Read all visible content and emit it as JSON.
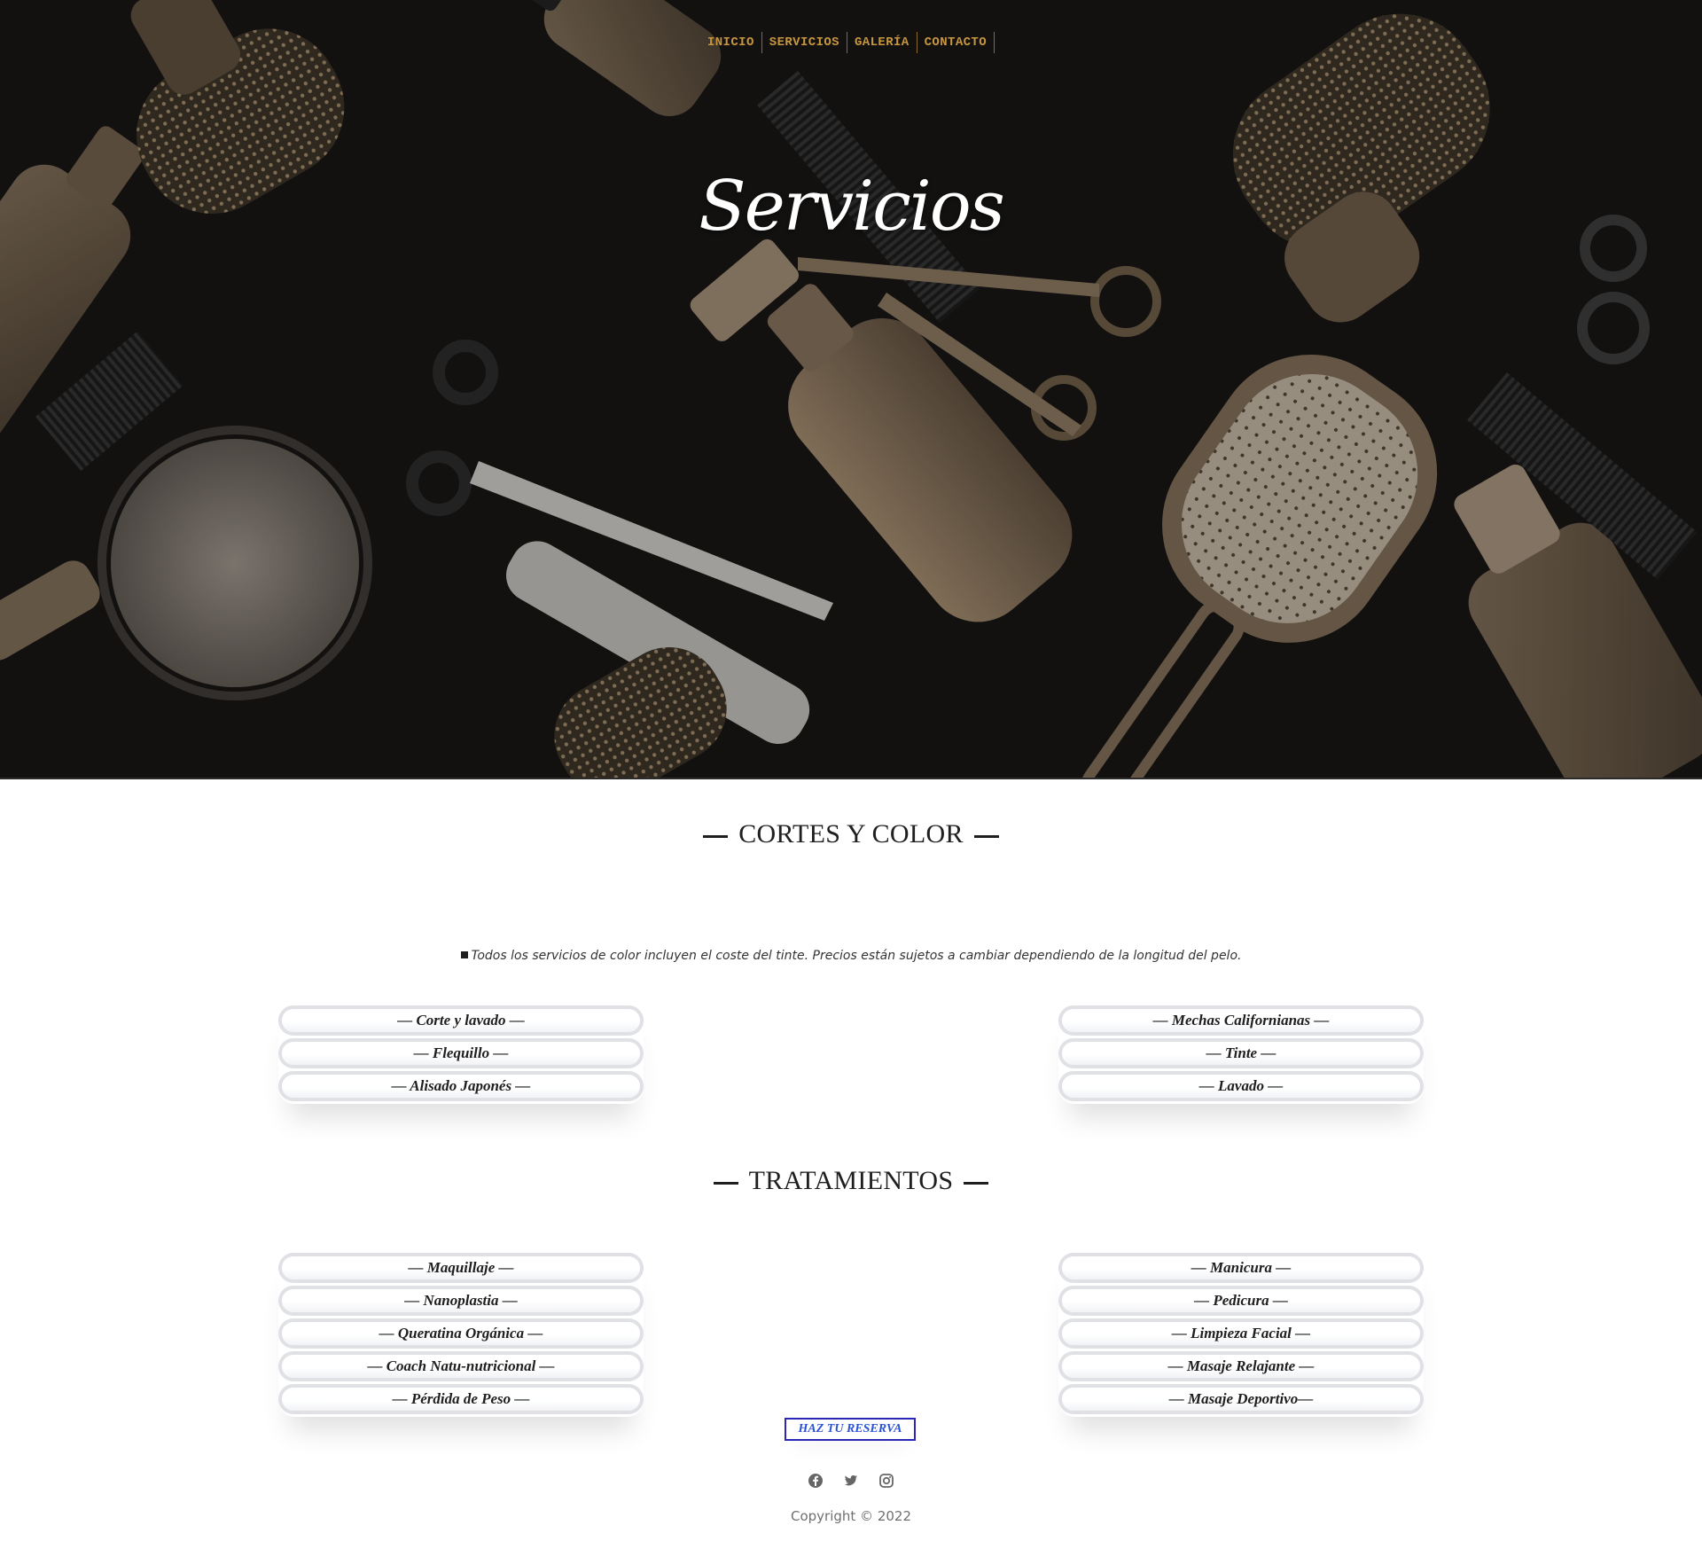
{
  "nav": {
    "items": [
      "INICIO",
      "SERVICIOS",
      "GALERÍA",
      "CONTACTO"
    ]
  },
  "hero": {
    "title": "Servicios"
  },
  "cortes": {
    "title": "CORTES Y COLOR",
    "note": "Todos los servicios de color incluyen el coste del tinte. Precios están sujetos a cambiar dependiendo de la longitud del pelo.",
    "left": [
      "— Corte y lavado —",
      "— Flequillo —",
      "— Alisado Japonés —"
    ],
    "right": [
      "— Mechas Californianas —",
      "— Tinte —",
      "— Lavado —"
    ]
  },
  "tratamientos": {
    "title": "TRATAMIENTOS",
    "left": [
      "— Maquillaje —",
      "— Nanoplastia —",
      "— Queratina Orgánica —",
      "— Coach Natu-nutricional —",
      "— Pérdida de Peso —"
    ],
    "right": [
      "— Manicura —",
      "— Pedicura —",
      "— Limpieza Facial —",
      "— Masaje Relajante —",
      "— Masaje Deportivo—"
    ]
  },
  "reserve": {
    "label": "HAZ TU RESERVA"
  },
  "footer": {
    "social_icons": [
      "facebook-icon",
      "twitter-icon",
      "instagram-icon"
    ],
    "copyright": "Copyright © 2022"
  },
  "colors": {
    "nav_gold": "#c7963f",
    "reserve_blue": "#2a52d6",
    "pill_border": "#dfe1e5"
  }
}
